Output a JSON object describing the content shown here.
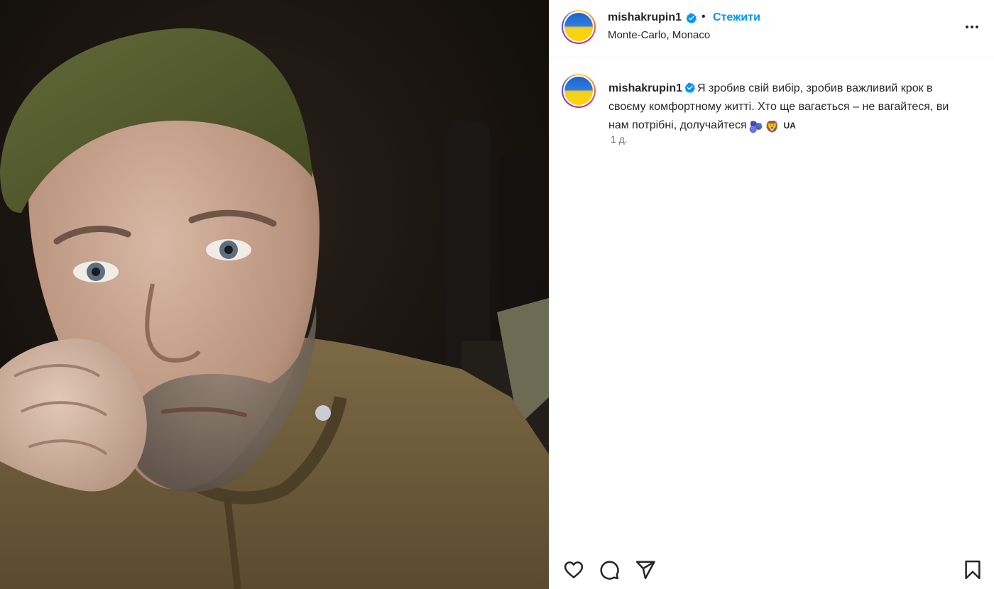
{
  "post": {
    "username": "mishakrupin1",
    "separator": "•",
    "follow_label": "Стежити",
    "location": "Monte-Carlo, Monaco",
    "caption": {
      "username": "mishakrupin1",
      "text": "Я зробив свій вибір, зробив важливий крок в своєму комфортному житті. Хто ще вагається – не вагайтеся, ви нам потрібні, долучайтеся",
      "emoji_1": "🫐",
      "emoji_2": "🦁",
      "tag": "UA"
    },
    "timestamp": "1 д."
  },
  "icons": {
    "verified": "verified-badge-icon",
    "more": "more-horizontal-icon",
    "like": "heart-icon",
    "comment": "comment-icon",
    "share": "send-icon",
    "save": "bookmark-icon"
  },
  "colors": {
    "accent": "#0095f6",
    "text": "#262626",
    "secondary": "#737373",
    "border": "#efefef",
    "flag_blue": "#1f64c8",
    "flag_yellow": "#ffd500"
  }
}
